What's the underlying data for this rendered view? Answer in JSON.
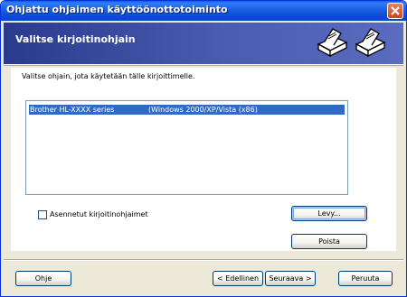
{
  "window": {
    "title": "Ohjattu ohjaimen käyttöönottotoiminto"
  },
  "banner": {
    "heading": "Valitse kirjoitinohjain",
    "icons": [
      "printer-icon",
      "printer-icon"
    ]
  },
  "content": {
    "instruction": "Valitse ohjain, jota käytetään tälle kirjoittimelle.",
    "drivers": [
      {
        "name": "Brother HL-XXXX series",
        "platform": "(Windows 2000/XP/Vista (x86)"
      }
    ],
    "installed_checkbox_label": "Asennetut kirjoitinohjaimet",
    "disk_button": "Levy...",
    "remove_button": "Poista"
  },
  "footer": {
    "help_button": "Ohje",
    "back_button": "< Edellinen",
    "next_button": "Seuraava >",
    "cancel_button": "Peruuta"
  },
  "colors": {
    "title_bar": "#0a4fd8",
    "banner": "#3a4a9c",
    "selection": "#316ac5",
    "face": "#ece9d8"
  }
}
